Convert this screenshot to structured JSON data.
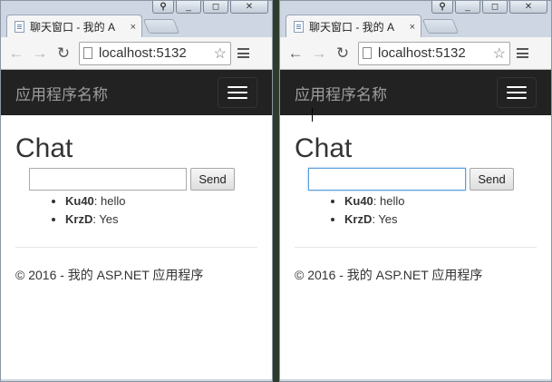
{
  "windows": [
    {
      "id": "left",
      "tab_title": "聊天窗口 - 我的 A",
      "tab_close": "×",
      "url": "localhost:5132",
      "brand": "应用程序名称",
      "heading": "Chat",
      "input_value": "",
      "input_focused": false,
      "send_label": "Send",
      "messages": [
        {
          "user": "Ku40",
          "text": ": hello"
        },
        {
          "user": "KrzD",
          "text": ": Yes"
        }
      ],
      "footer": "© 2016 - 我的 ASP.NET 应用程序"
    },
    {
      "id": "right",
      "tab_title": "聊天窗口 - 我的 A",
      "tab_close": "×",
      "url": "localhost:5132",
      "brand": "应用程序名称",
      "heading": "Chat",
      "input_value": "",
      "input_focused": true,
      "send_label": "Send",
      "messages": [
        {
          "user": "Ku40",
          "text": ": hello"
        },
        {
          "user": "KrzD",
          "text": ": Yes"
        }
      ],
      "footer": "© 2016 - 我的 ASP.NET 应用程序"
    }
  ],
  "icons": {
    "back": "←",
    "forward": "→",
    "reload": "↻",
    "star": "☆",
    "minimize": "▭",
    "maximize": "◻",
    "close": "✕",
    "user": "⚲"
  },
  "colors": {
    "navbar_bg": "#222222",
    "brand_text": "#9d9d9d",
    "focus_border": "#5b9dd9"
  }
}
